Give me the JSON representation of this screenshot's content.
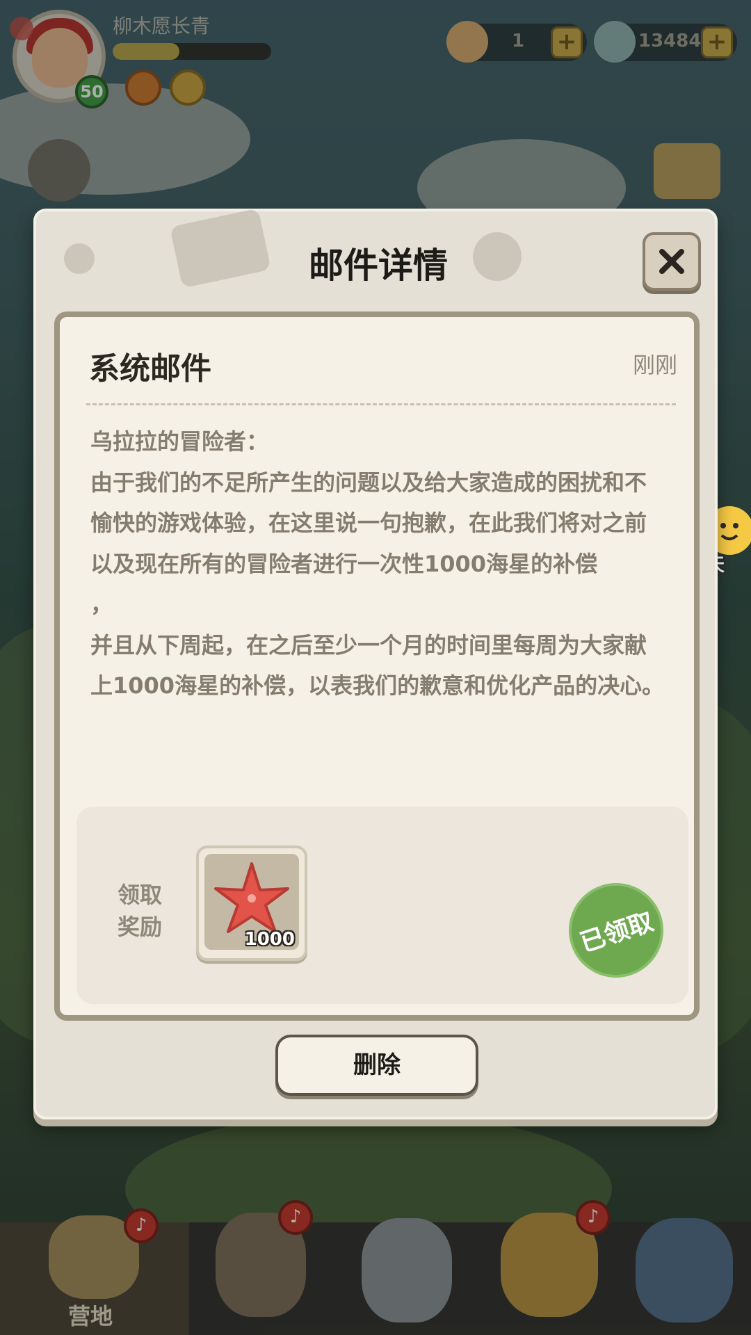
{
  "player": {
    "name": "柳木愿长青",
    "level": "50",
    "xp_fraction": 0.42
  },
  "currencies": [
    {
      "name": "starfish-currency",
      "value": "1"
    },
    {
      "name": "shell-currency",
      "value": "13484"
    }
  ],
  "dialog": {
    "title": "邮件详情",
    "mail": {
      "subject": "系统邮件",
      "time": "刚刚",
      "body": [
        "乌拉拉的冒险者：",
        "由于我们的不足所产生的问题以及给大家造成的困扰和不愉快的游戏体验，在这里说一句抱歉，在此我们将对之前以及现在所有的冒险者进行一次性1000海星的补偿",
        "，",
        "并且从下周起，在之后至少一个月的时间里每周为大家献上1000海星的补偿，以表我们的歉意和优化产品的决心。"
      ]
    },
    "reward": {
      "label": "领取奖励",
      "item_icon": "starfish-icon",
      "item_quantity": "1000",
      "status": "已领取"
    },
    "delete_label": "删除"
  },
  "chat": {
    "label": "聊天"
  },
  "bottom_nav": {
    "active_label": "营地"
  },
  "colors": {
    "dialog_bg": "#e5e0d6",
    "claimed_green": "#6ea84f",
    "notification_red": "#c63226"
  }
}
